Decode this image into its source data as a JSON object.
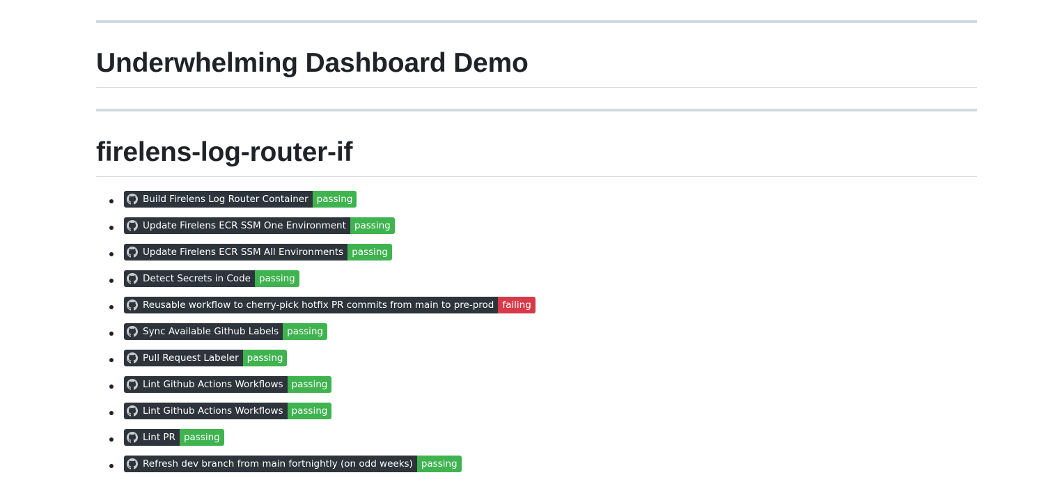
{
  "page": {
    "title": "Underwhelming Dashboard Demo"
  },
  "section": {
    "heading": "firelens-log-router-if"
  },
  "icon": "github-icon",
  "colors": {
    "badge_label_bg": "#2e343b",
    "passing": "#3fb34f",
    "failing": "#d73a49"
  },
  "workflows": [
    {
      "name": "Build Firelens Log Router Container",
      "status": "passing"
    },
    {
      "name": "Update Firelens ECR SSM One Environment",
      "status": "passing"
    },
    {
      "name": "Update Firelens ECR SSM All Environments",
      "status": "passing"
    },
    {
      "name": "Detect Secrets in Code",
      "status": "passing"
    },
    {
      "name": "Reusable workflow to cherry-pick hotfix PR commits from main to pre-prod",
      "status": "failing"
    },
    {
      "name": "Sync Available Github Labels",
      "status": "passing"
    },
    {
      "name": "Pull Request Labeler",
      "status": "passing"
    },
    {
      "name": "Lint Github Actions Workflows",
      "status": "passing"
    },
    {
      "name": "Lint Github Actions Workflows",
      "status": "passing"
    },
    {
      "name": "Lint PR",
      "status": "passing"
    },
    {
      "name": "Refresh dev branch from main fortnightly (on odd weeks)",
      "status": "passing"
    }
  ]
}
